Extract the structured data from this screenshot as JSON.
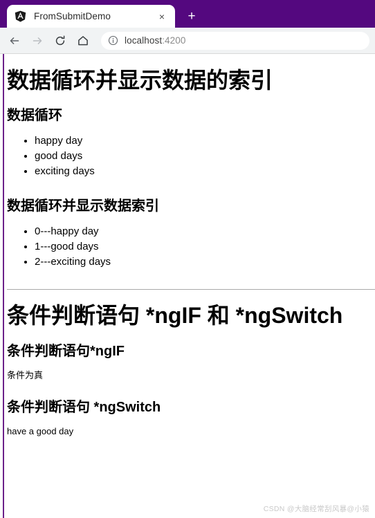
{
  "browser": {
    "tab": {
      "favicon_name": "angular-logo-icon",
      "title": "FromSubmitDemo",
      "close_label": "×"
    },
    "new_tab_label": "+",
    "toolbar": {
      "back_label": "back-arrow-icon",
      "forward_label": "forward-arrow-icon",
      "reload_label": "reload-icon",
      "home_label": "home-icon",
      "security_icon_name": "info-circle-icon",
      "url_host": "localhost",
      "url_port": ":4200",
      "url_full": "localhost:4200"
    },
    "colors": {
      "tabstrip_purple": "#54087F",
      "toolbar_grey": "#F1F3F4",
      "page_edge_purple": "#6B2089"
    }
  },
  "page": {
    "section_loop": {
      "h1": "数据循环并显示数据的索引",
      "h3_basic": "数据循环",
      "list_basic": [
        "happy day",
        "good days",
        "exciting days"
      ],
      "h3_indexed": "数据循环并显示数据索引",
      "list_indexed": [
        "0---happy day",
        "1---good days",
        "2---exciting days"
      ]
    },
    "section_conditional": {
      "h1": "条件判断语句 *ngIF 和 *ngSwitch",
      "h3_ngif": "条件判断语句*ngIF",
      "ngif_output": "条件为真",
      "h3_ngswitch": "条件判断语句 *ngSwitch",
      "ngswitch_output": "have a good day"
    },
    "watermark": "CSDN @大脑经常刮风暴@小猿"
  }
}
